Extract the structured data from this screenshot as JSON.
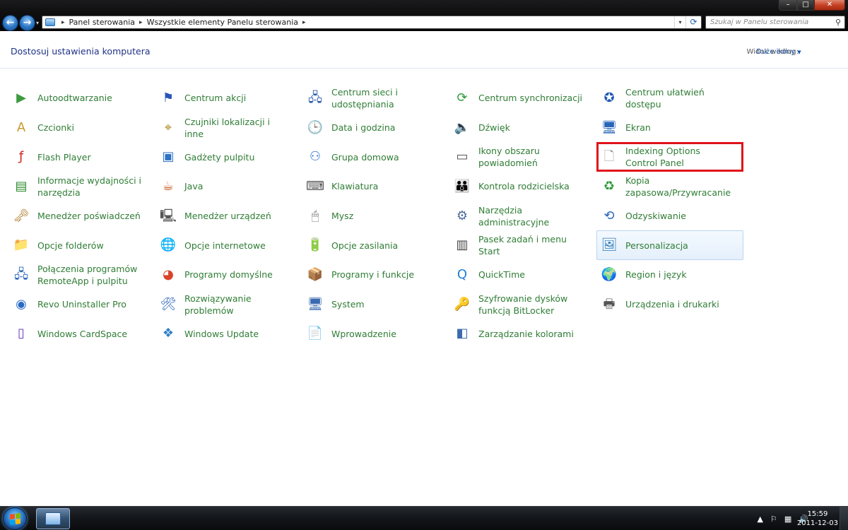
{
  "window": {
    "min_glyph": "–",
    "max_glyph": "□",
    "close_glyph": "✕"
  },
  "nav": {
    "back_glyph": "←",
    "forward_glyph": "→",
    "recent_glyph": "▾"
  },
  "address": {
    "breadcrumb": [
      "Panel sterowania",
      "Wszystkie elementy Panelu sterowania"
    ],
    "separator": "▸",
    "dropdown_glyph": "▾",
    "refresh_glyph": "⟳"
  },
  "search": {
    "placeholder": "Szukaj w Panelu sterowania",
    "icon_glyph": "⚲"
  },
  "header": {
    "title": "Dostosuj ustawienia komputera",
    "view_by_label": "Widok według:",
    "view_by_value": "Duże ikony",
    "view_by_caret": "▼"
  },
  "items": [
    {
      "label": "Autoodtwarzanie",
      "icon": "autoplay-icon",
      "glyph": "▶",
      "color": "#3c9a3f"
    },
    {
      "label": "Centrum akcji",
      "icon": "action-center-flag-icon",
      "glyph": "⚑",
      "color": "#2a55b8"
    },
    {
      "label": "Centrum sieci i udostępniania",
      "icon": "network-center-icon",
      "glyph": "🖧",
      "color": "#2a5aa8"
    },
    {
      "label": "Centrum synchronizacji",
      "icon": "sync-center-icon",
      "glyph": "⟳",
      "color": "#2f9e3a"
    },
    {
      "label": "Centrum ułatwień dostępu",
      "icon": "ease-of-access-icon",
      "glyph": "✪",
      "color": "#1f58b5"
    },
    {
      "label": "Czcionki",
      "icon": "fonts-icon",
      "glyph": "A",
      "color": "#c99a2a"
    },
    {
      "label": "Czujniki lokalizacji i inne",
      "icon": "location-sensors-icon",
      "glyph": "⌖",
      "color": "#b28a2a"
    },
    {
      "label": "Data i godzina",
      "icon": "date-time-icon",
      "glyph": "🕒",
      "color": "#3a6bb0"
    },
    {
      "label": "Dźwięk",
      "icon": "sound-speaker-icon",
      "glyph": "🔈",
      "color": "#7a7a7a"
    },
    {
      "label": "Ekran",
      "icon": "display-icon",
      "glyph": "🖥",
      "color": "#2a66b8"
    },
    {
      "label": "Flash Player",
      "icon": "flash-player-icon",
      "glyph": "ƒ",
      "color": "#d2231c"
    },
    {
      "label": "Gadżety pulpitu",
      "icon": "desktop-gadgets-icon",
      "glyph": "▣",
      "color": "#2f72c4"
    },
    {
      "label": "Grupa domowa",
      "icon": "homegroup-icon",
      "glyph": "⚇",
      "color": "#2f74c8"
    },
    {
      "label": "Ikony obszaru powiadomień",
      "icon": "notification-area-icon",
      "glyph": "▭",
      "color": "#555555"
    },
    {
      "label": "Indexing Options Control Panel",
      "icon": "blank-document-icon",
      "glyph": "🗋",
      "color": "#9a9a9a"
    },
    {
      "label": "Informacje wydajności i narzędzia",
      "icon": "performance-info-icon",
      "glyph": "▤",
      "color": "#2e8a2e"
    },
    {
      "label": "Java",
      "icon": "java-cup-icon",
      "glyph": "☕",
      "color": "#c2571b"
    },
    {
      "label": "Klawiatura",
      "icon": "keyboard-icon",
      "glyph": "⌨",
      "color": "#555555"
    },
    {
      "label": "Kontrola rodzicielska",
      "icon": "parental-controls-icon",
      "glyph": "👪",
      "color": "#c28a2a"
    },
    {
      "label": "Kopia zapasowa/Przywracanie",
      "icon": "backup-restore-icon",
      "glyph": "♻",
      "color": "#2e9a3a"
    },
    {
      "label": "Menedżer poświadczeń",
      "icon": "credential-manager-icon",
      "glyph": "🗝",
      "color": "#b07a2a"
    },
    {
      "label": "Menedżer urządzeń",
      "icon": "device-manager-icon",
      "glyph": "🖳",
      "color": "#555555"
    },
    {
      "label": "Mysz",
      "icon": "mouse-icon",
      "glyph": "🖱",
      "color": "#777777"
    },
    {
      "label": "Narzędzia administracyjne",
      "icon": "admin-tools-icon",
      "glyph": "⚙",
      "color": "#4a6a9a"
    },
    {
      "label": "Odzyskiwanie",
      "icon": "recovery-icon",
      "glyph": "⟲",
      "color": "#2a66b8"
    },
    {
      "label": "Opcje folderów",
      "icon": "folder-options-icon",
      "glyph": "📁",
      "color": "#d9a53a"
    },
    {
      "label": "Opcje internetowe",
      "icon": "internet-options-icon",
      "glyph": "🌐",
      "color": "#2f7fc4"
    },
    {
      "label": "Opcje zasilania",
      "icon": "power-options-icon",
      "glyph": "🔋",
      "color": "#2e8a2e"
    },
    {
      "label": "Pasek zadań i menu Start",
      "icon": "taskbar-start-menu-icon",
      "glyph": "▥",
      "color": "#444444"
    },
    {
      "label": "Personalizacja",
      "icon": "personalization-icon",
      "glyph": "🖼",
      "color": "#2a7ab8"
    },
    {
      "label": "Połączenia programów RemoteApp i pulpitu",
      "icon": "remoteapp-icon",
      "glyph": "🖧",
      "color": "#2a66b8"
    },
    {
      "label": "Programy domyślne",
      "icon": "default-programs-icon",
      "glyph": "◕",
      "color": "#d9432a"
    },
    {
      "label": "Programy i funkcje",
      "icon": "programs-features-icon",
      "glyph": "📦",
      "color": "#6a6a6a"
    },
    {
      "label": "QuickTime",
      "icon": "quicktime-icon",
      "glyph": "Q",
      "color": "#1f7fd4"
    },
    {
      "label": "Region i język",
      "icon": "region-language-icon",
      "glyph": "🌍",
      "color": "#2a66b8"
    },
    {
      "label": "Revo Uninstaller Pro",
      "icon": "revo-uninstaller-icon",
      "glyph": "◉",
      "color": "#2a6ac4"
    },
    {
      "label": "Rozwiązywanie problemów",
      "icon": "troubleshooting-icon",
      "glyph": "🛠",
      "color": "#2a66b8"
    },
    {
      "label": "System",
      "icon": "system-icon",
      "glyph": "🖥",
      "color": "#3a6ab0"
    },
    {
      "label": "Szyfrowanie dysków funkcją BitLocker",
      "icon": "bitlocker-key-icon",
      "glyph": "🔑",
      "color": "#c2962a"
    },
    {
      "label": "Urządzenia i drukarki",
      "icon": "devices-printers-icon",
      "glyph": "🖶",
      "color": "#555555"
    },
    {
      "label": "Windows CardSpace",
      "icon": "cardspace-icon",
      "glyph": "▯",
      "color": "#6a3ac4"
    },
    {
      "label": "Windows Update",
      "icon": "windows-update-icon",
      "glyph": "❖",
      "color": "#2f7fc4"
    },
    {
      "label": "Wprowadzenie",
      "icon": "getting-started-icon",
      "glyph": "📄",
      "color": "#3a8ac4"
    },
    {
      "label": "Zarządzanie kolorami",
      "icon": "color-management-icon",
      "glyph": "◧",
      "color": "#3a6ab0"
    }
  ],
  "state": {
    "highlighted_item": "Indexing Options Control Panel",
    "hovered_item": "Personalizacja"
  },
  "taskbar": {
    "tray_arrow": "▲",
    "tray_flag": "⚐",
    "tray_network": "▦",
    "tray_volume": "🔊",
    "time": "15:59",
    "date": "2011-12-03"
  }
}
